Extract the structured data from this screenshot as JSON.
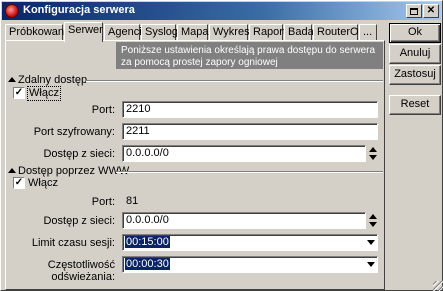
{
  "window": {
    "title": "Konfiguracja serwera"
  },
  "tabs": [
    {
      "label": "Próbkowanie"
    },
    {
      "label": "Serwer"
    },
    {
      "label": "Agenci"
    },
    {
      "label": "Syslog"
    },
    {
      "label": "Mapa"
    },
    {
      "label": "Wykres"
    },
    {
      "label": "Raport"
    },
    {
      "label": "Badaj"
    },
    {
      "label": "RouterOS"
    },
    {
      "label": "..."
    }
  ],
  "active_tab": "Serwer",
  "notice": "Poniższe ustawienia określają prawa dostępu do serwera za pomocą prostej zapory ogniowej",
  "buttons": {
    "ok": "Ok",
    "cancel": "Anuluj",
    "apply": "Zastosuj",
    "reset": "Reset"
  },
  "remote_access": {
    "header": "Zdalny dostęp",
    "enable_label": "Włącz",
    "enabled": true,
    "port_label": "Port:",
    "port": "2210",
    "secure_port_label": "Port szyfrowany:",
    "secure_port": "2211",
    "access_label": "Dostęp z sieci:",
    "access": "0.0.0.0/0"
  },
  "web_access": {
    "header": "Dostęp poprzez WWW",
    "enable_label": "Włącz",
    "enabled": true,
    "port_label": "Port:",
    "port": "81",
    "access_label": "Dostęp z sieci:",
    "access": "0.0.0.0/0",
    "session_label": "Limit czasu sesji:",
    "session": "00:15:00",
    "refresh_label": "Częstotliwość odświeżania:",
    "refresh": "00:00:30"
  }
}
